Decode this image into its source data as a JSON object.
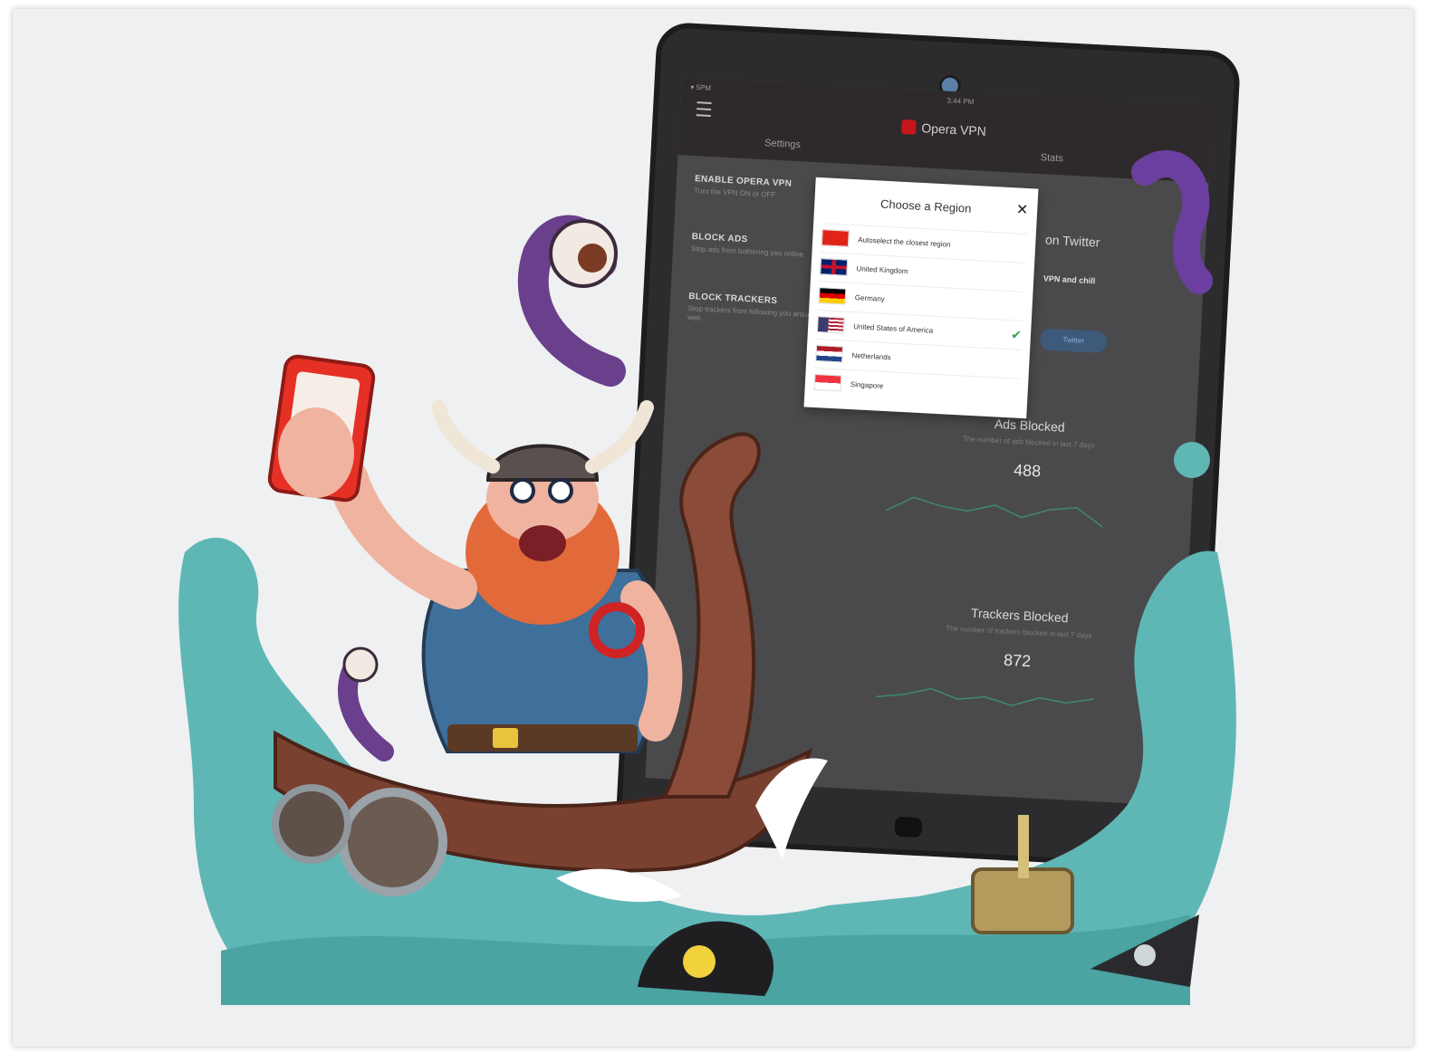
{
  "app": {
    "logo": "Opera VPN",
    "status_left": "▾ 5PM",
    "status_time": "3:44 PM"
  },
  "tabs": {
    "settings": "Settings",
    "stats": "Stats"
  },
  "settings": [
    {
      "title": "ENABLE OPERA VPN",
      "desc": "Turn the VPN ON or OFF"
    },
    {
      "title": "BLOCK ADS",
      "desc": "Stop ads from bothering you online"
    },
    {
      "title": "BLOCK TRACKERS",
      "desc": "Stop trackers from following you around the web"
    }
  ],
  "promo": {
    "title": "on Twitter",
    "chill": "VPN and chill",
    "button": "Twitter"
  },
  "stats": {
    "ads_title": "Ads Blocked",
    "ads_desc": "The number of ads blocked in last 7 days",
    "ads_count": "488",
    "trackers_title": "Trackers Blocked",
    "trackers_desc": "The number of trackers blocked in last 7 days",
    "trackers_count": "872"
  },
  "dialog": {
    "title": "Choose a Region",
    "close": "✕",
    "regions": [
      {
        "label": "Autoselect the closest region",
        "flag": "auto",
        "selected": false
      },
      {
        "label": "United Kingdom",
        "flag": "uk",
        "selected": false
      },
      {
        "label": "Germany",
        "flag": "de",
        "selected": false
      },
      {
        "label": "United States of America",
        "flag": "us",
        "selected": true
      },
      {
        "label": "Netherlands",
        "flag": "nl",
        "selected": false
      },
      {
        "label": "Singapore",
        "flag": "sg",
        "selected": false
      }
    ]
  },
  "colors": {
    "accent": "#c4161c",
    "check": "#3aa05c",
    "sea": "#5fb7b5"
  }
}
